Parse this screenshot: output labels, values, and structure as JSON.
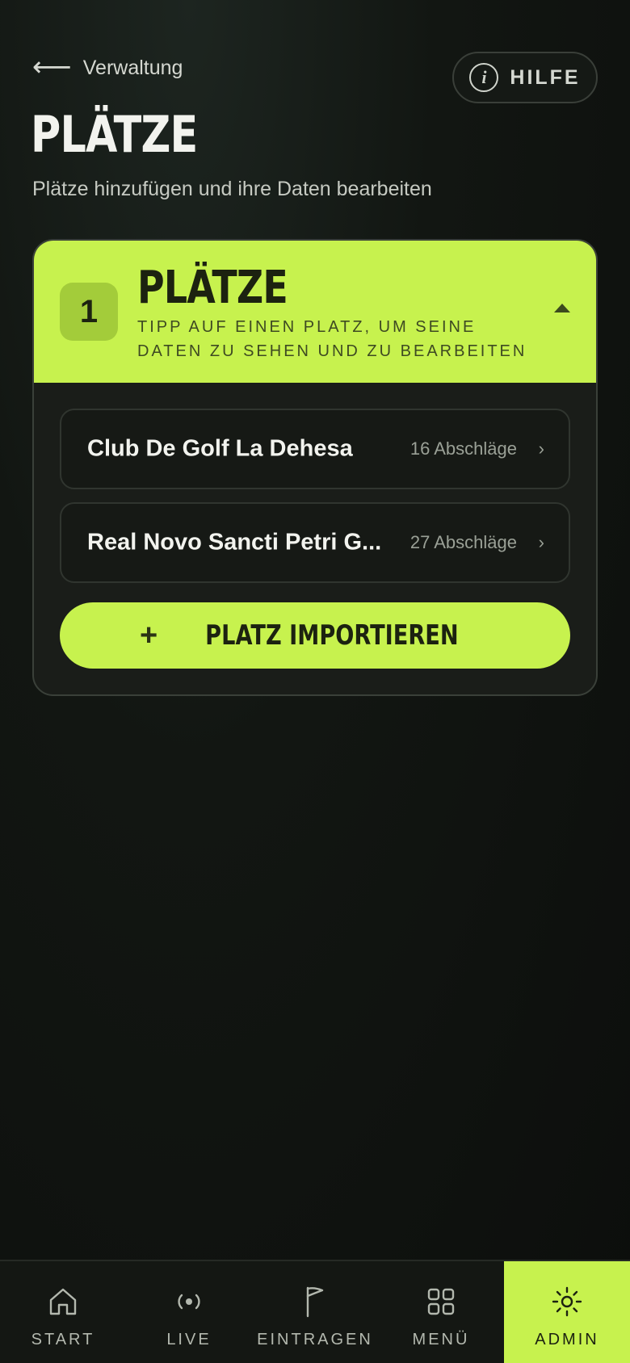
{
  "header": {
    "back_label": "Verwaltung",
    "help_label": "HILFE",
    "title": "PLÄTZE",
    "subtitle": "Plätze hinzufügen und ihre Daten bearbeiten"
  },
  "card": {
    "count": "1",
    "title": "PLÄTZE",
    "hint": "TIPP AUF EINEN PLATZ, UM SEINE DATEN ZU SEHEN UND ZU BEARBEITEN",
    "courses": [
      {
        "name": "Club De Golf La Dehesa",
        "tees": "16 Abschläge"
      },
      {
        "name": "Real Novo Sancti Petri G...",
        "tees": "27 Abschläge"
      }
    ],
    "import_label": "PLATZ IMPORTIEREN"
  },
  "tabbar": {
    "items": [
      {
        "label": "START",
        "icon": "home-icon"
      },
      {
        "label": "LIVE",
        "icon": "live-broadcast-icon"
      },
      {
        "label": "EINTRAGEN",
        "icon": "flag-icon"
      },
      {
        "label": "MENÜ",
        "icon": "grid-icon"
      },
      {
        "label": "ADMIN",
        "icon": "gear-icon"
      }
    ],
    "active": "ADMIN"
  },
  "colors": {
    "accent": "#c7f24e",
    "background": "#0f120f",
    "card": "#1a1d19"
  }
}
